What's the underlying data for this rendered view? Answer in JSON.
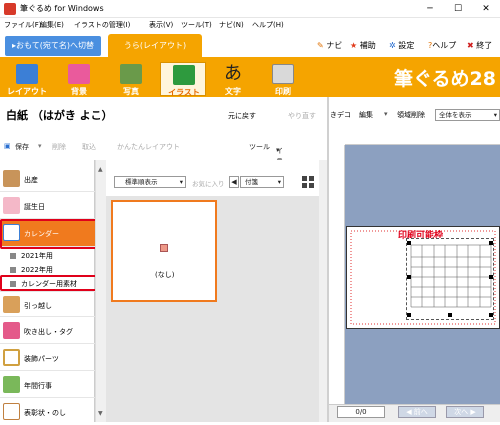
{
  "window": {
    "title": "筆ぐるめ for Windows",
    "min": "─",
    "max": "☐",
    "close": "✕"
  },
  "menu": [
    "ファイル(F)",
    "編集(E)",
    "イラストの管理(I)",
    "表示(V)",
    "ツール(T)",
    "ナビ(N)",
    "ヘルプ(H)"
  ],
  "tabs": {
    "omote": "▸おもて(宛て名)へ切替",
    "ura": "うら(レイアウト)"
  },
  "topcmds": {
    "navi": "ナビ",
    "hosoku": "補助",
    "settei": "設定",
    "help": "ヘルプ",
    "exit": "終了"
  },
  "ribbon": {
    "layout": "レイアウト",
    "haikei": "背景",
    "shashin": "写真",
    "illust": "イラスト",
    "moji": "文字",
    "insatsu": "印刷",
    "brand": "筆ぐるめ28"
  },
  "doc": {
    "title": "白紙 （はがき よこ）",
    "undo": "元に戻す",
    "redo": "やり直す"
  },
  "toolbar2": {
    "save": "保存",
    "del": "削除",
    "get": "取込",
    "easy": "かんたんレイアウト",
    "tool": "ツール",
    "add": "イラスト追加"
  },
  "categories": {
    "shussan": "出産",
    "tanjobi": "誕生日",
    "calendar": "カレンダー",
    "y2021": "2021年用",
    "y2022": "2022年用",
    "sozai": "カレンダー用素材",
    "hikkoshi": "引っ越し",
    "fukidashi": "吹き出し・タグ",
    "soshoku": "装飾パーツ",
    "nenchu": "年間行事",
    "hyosho": "表彰状・のし"
  },
  "grid": {
    "view": "標準順表示",
    "favs": "お気に入り",
    "nav": "◀",
    "sort": "付箋",
    "thumb_label": "(なし)"
  },
  "preview": {
    "decor": "きデコ",
    "edit": "編集",
    "area_del": "領域削除",
    "zoom": "全体を表示",
    "card_title": "印刷可能枠",
    "pages": "0/0",
    "prev": "◀ 前へ",
    "next": "次へ ▶"
  }
}
